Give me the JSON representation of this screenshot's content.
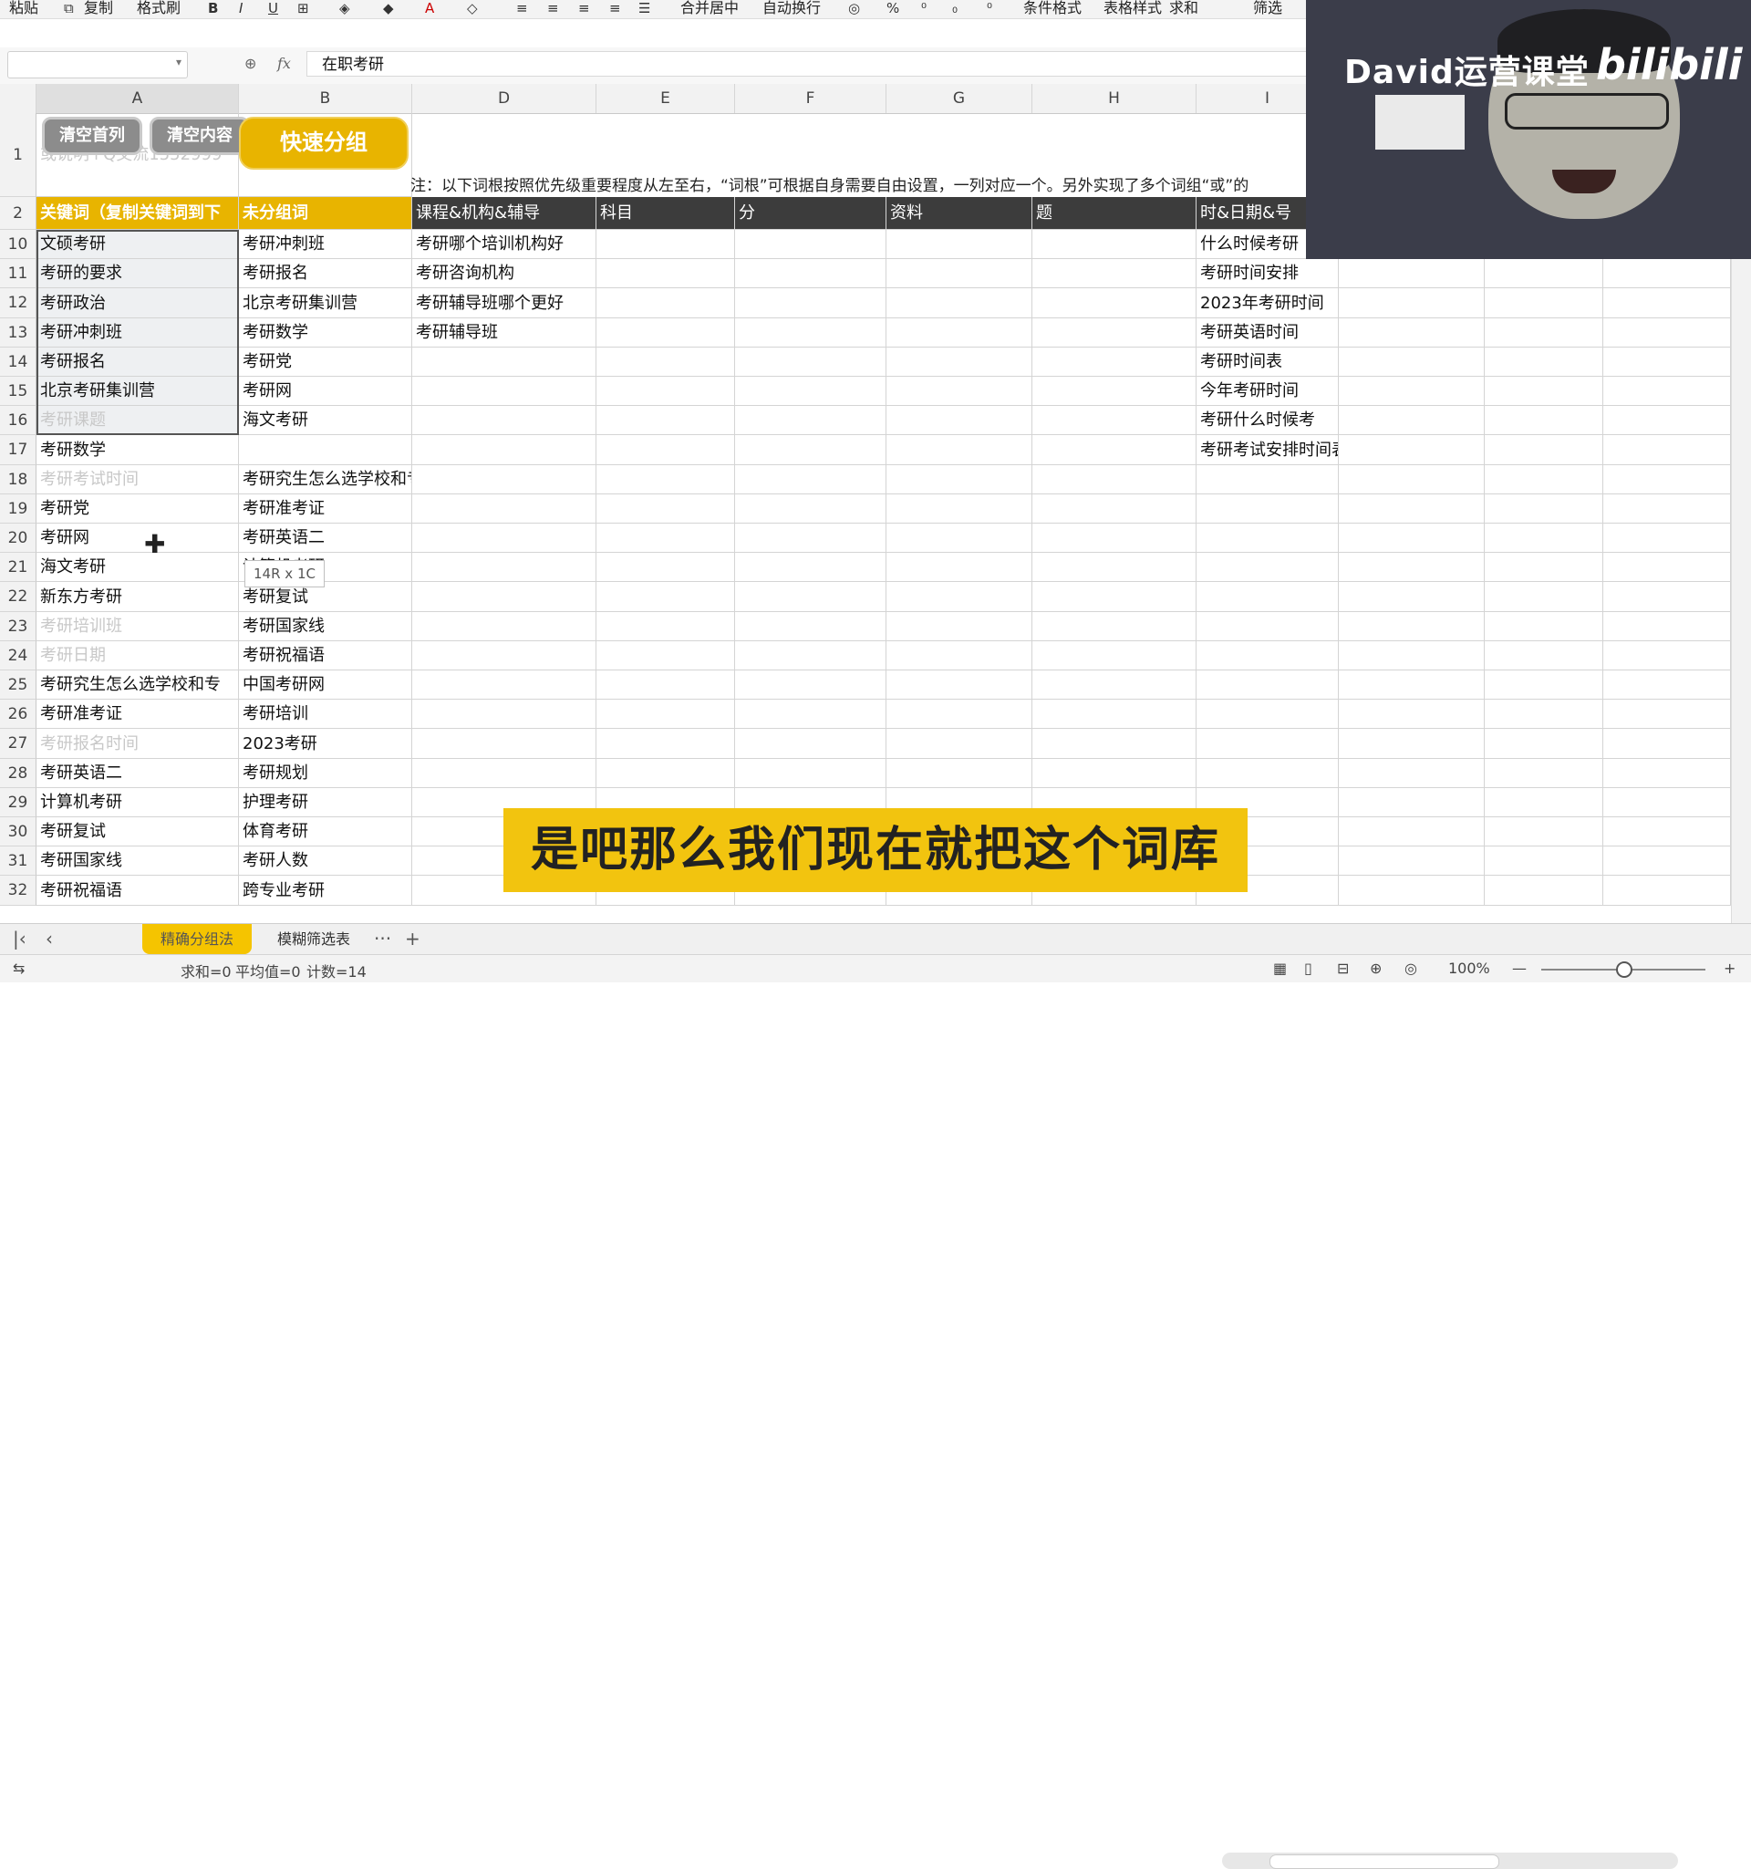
{
  "ribbon": {
    "items": [
      {
        "label": "粘贴"
      },
      {
        "label": "复制"
      },
      {
        "label": "格式刷"
      },
      {
        "label": "合并居中"
      },
      {
        "label": "自动换行"
      },
      {
        "label": "条件格式"
      },
      {
        "label": "表格样式"
      },
      {
        "label": "求和"
      },
      {
        "label": "筛选"
      }
    ],
    "icons": [
      "bold-icon",
      "italic-icon",
      "underline-icon",
      "border-icon",
      "fill-color-icon",
      "font-color-icon",
      "clear-format-icon",
      "align-left-icon",
      "align-center-icon",
      "align-right-icon",
      "justify-icon",
      "percent-icon"
    ]
  },
  "formula_bar": {
    "fx": "fx",
    "value": "在职考研"
  },
  "columns": [
    "A",
    "B",
    "D",
    "E",
    "F",
    "G",
    "H",
    "I"
  ],
  "buttons": {
    "clear_first_col": "清空首列",
    "clear_content": "清空内容",
    "quick_group": "快速分组"
  },
  "row1_note": "注：以下词根按照优先级重要程度从左至右，“词根”可根据自身需要自由设置，一列对应一个。另外实现了多个词组“或”的",
  "row1_a_partial": "或说明+Q交流1552999",
  "row2": {
    "a": "关键词（复制关键词到下",
    "b": "未分组词",
    "d": "课程&机构&辅导",
    "e": "科目",
    "f": "分",
    "g": "资料",
    "h": "题",
    "i": "时&日期&号"
  },
  "rows": [
    {
      "num": "10",
      "a": "文硕考研",
      "b": "考研冲刺班",
      "d": "考研哪个培训机构好",
      "i": "什么时候考研"
    },
    {
      "num": "11",
      "a": "考研的要求",
      "b": "考研报名",
      "d": "考研咨询机构",
      "i": "考研时间安排"
    },
    {
      "num": "12",
      "a": "考研政治",
      "b": "北京考研集训营",
      "d": "考研辅导班哪个更好",
      "i": "2023年考研时间"
    },
    {
      "num": "13",
      "a": "考研冲刺班",
      "b": "考研数学",
      "d": "考研辅导班",
      "i": "考研英语时间"
    },
    {
      "num": "14",
      "a": "考研报名",
      "b": "考研党",
      "d": "",
      "i": "考研时间表"
    },
    {
      "num": "15",
      "a": "北京考研集训营",
      "b": "考研网",
      "d": "",
      "i": "今年考研时间"
    },
    {
      "num": "16",
      "a": "考研课题",
      "b": "海文考研",
      "d": "",
      "i": "考研什么时候考",
      "a_faded": true
    },
    {
      "num": "17",
      "a": "考研数学",
      "b": "",
      "d": "",
      "i": "考研考试安排时间表"
    },
    {
      "num": "18",
      "a": "考研考试时间",
      "b": "考研究生怎么选学校和专",
      "d": "",
      "i": "",
      "a_faded": true
    },
    {
      "num": "19",
      "a": "考研党",
      "b": "考研准考证",
      "d": "",
      "i": ""
    },
    {
      "num": "20",
      "a": "考研网",
      "b": "考研英语二",
      "d": "",
      "i": ""
    },
    {
      "num": "21",
      "a": "海文考研",
      "b": "计算机考研",
      "d": "",
      "i": ""
    },
    {
      "num": "22",
      "a": "新东方考研",
      "b": "考研复试",
      "d": "",
      "i": ""
    },
    {
      "num": "23",
      "a": "考研培训班",
      "b": "考研国家线",
      "d": "",
      "i": "",
      "a_faded": true
    },
    {
      "num": "24",
      "a": "考研日期",
      "b": "考研祝福语",
      "d": "",
      "i": "",
      "a_faded": true
    },
    {
      "num": "25",
      "a": "考研究生怎么选学校和专",
      "b": "中国考研网",
      "d": "",
      "i": ""
    },
    {
      "num": "26",
      "a": "考研准考证",
      "b": "考研培训",
      "d": "",
      "i": ""
    },
    {
      "num": "27",
      "a": "考研报名时间",
      "b": "2023考研",
      "d": "",
      "i": "",
      "a_faded": true
    },
    {
      "num": "28",
      "a": "考研英语二",
      "b": "考研规划",
      "d": "",
      "i": ""
    },
    {
      "num": "29",
      "a": "计算机考研",
      "b": "护理考研",
      "d": "",
      "i": ""
    },
    {
      "num": "30",
      "a": "考研复试",
      "b": "体育考研",
      "d": "",
      "i": ""
    },
    {
      "num": "31",
      "a": "考研国家线",
      "b": "考研人数",
      "d": "",
      "i": ""
    },
    {
      "num": "32",
      "a": "考研祝福语",
      "b": "跨专业考研",
      "d": "",
      "i": ""
    }
  ],
  "selection_tip": "14R x 1C",
  "overlay": {
    "title": "David运营课堂",
    "logo": "bilibili"
  },
  "subtitle": "是吧那么我们现在就把这个词库",
  "sheet_tabs": [
    {
      "label": "精确分组法",
      "active": true
    },
    {
      "label": "模糊筛选表",
      "active": false
    }
  ],
  "tab_more": "···",
  "tab_add": "+",
  "status": {
    "sum": "求和=0",
    "avg": "平均值=0",
    "count": "计数=14",
    "zoom": "100%"
  }
}
